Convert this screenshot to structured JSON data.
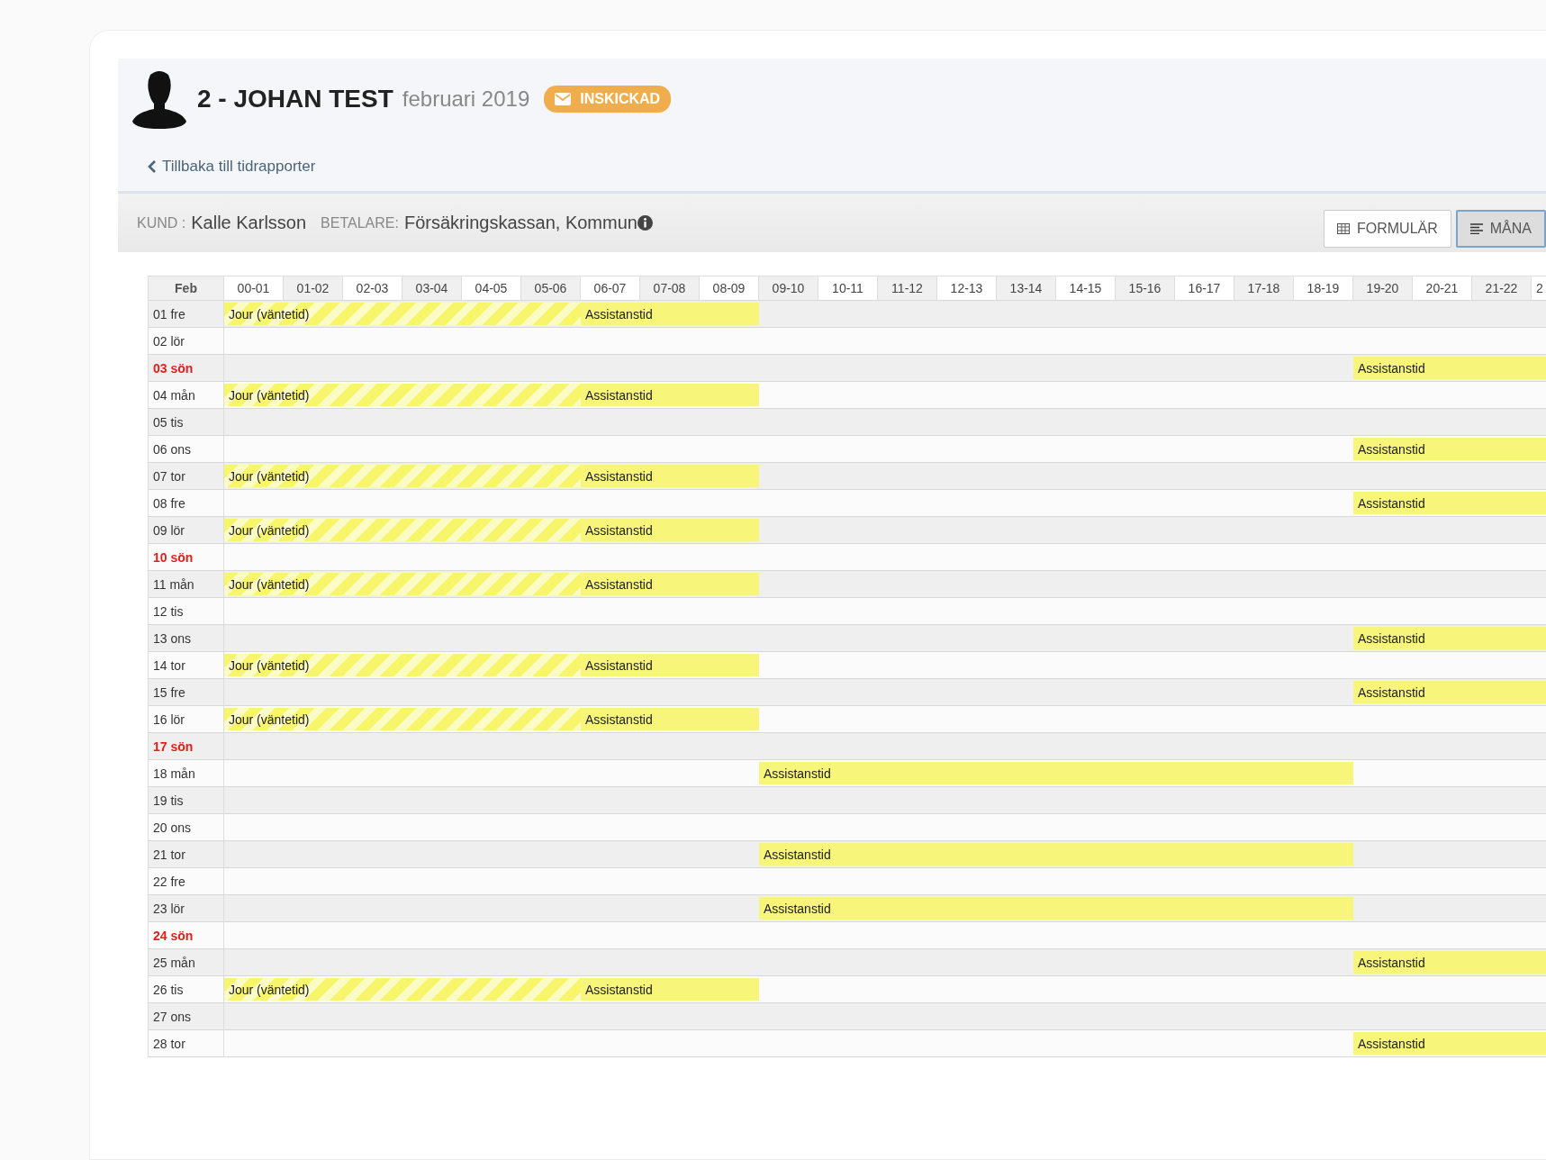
{
  "header": {
    "title": "2 - JOHAN TEST",
    "period": "februari 2019",
    "status": "INSKICKAD",
    "back_link": "Tillbaka till tidrapporter"
  },
  "info_bar": {
    "customer_label": "KUND :",
    "customer": "Kalle Karlsson",
    "payer_label": "BETALARE:",
    "payer": "Försäkringskassan, Kommun",
    "view_buttons": [
      {
        "label": "FORMULÄR",
        "kind": "form",
        "selected": false
      },
      {
        "label": "MÅNA",
        "kind": "month",
        "selected": true
      }
    ]
  },
  "table": {
    "corner": "Feb",
    "columns": [
      "00-01",
      "01-02",
      "02-03",
      "03-04",
      "04-05",
      "05-06",
      "06-07",
      "07-08",
      "08-09",
      "09-10",
      "10-11",
      "11-12",
      "12-13",
      "13-14",
      "14-15",
      "15-16",
      "16-17",
      "17-18",
      "18-19",
      "19-20",
      "20-21",
      "21-22",
      "2"
    ],
    "days": [
      {
        "label": "01 fre",
        "sunday": false,
        "shifts": [
          {
            "kind": "night",
            "label": "Jour (väntetid)"
          },
          {
            "kind": "morning",
            "label": "Assistanstid"
          }
        ]
      },
      {
        "label": "02 lör",
        "sunday": false
      },
      {
        "label": "03 sön",
        "sunday": true,
        "shifts": [
          {
            "kind": "evening",
            "label": "Assistanstid"
          }
        ]
      },
      {
        "label": "04 mån",
        "sunday": false,
        "shifts": [
          {
            "kind": "night",
            "label": "Jour (väntetid)"
          },
          {
            "kind": "morning",
            "label": "Assistanstid"
          }
        ]
      },
      {
        "label": "05 tis",
        "sunday": false
      },
      {
        "label": "06 ons",
        "sunday": false,
        "shifts": [
          {
            "kind": "evening",
            "label": "Assistanstid"
          }
        ]
      },
      {
        "label": "07 tor",
        "sunday": false,
        "shifts": [
          {
            "kind": "night",
            "label": "Jour (väntetid)"
          },
          {
            "kind": "morning",
            "label": "Assistanstid"
          }
        ]
      },
      {
        "label": "08 fre",
        "sunday": false,
        "shifts": [
          {
            "kind": "evening",
            "label": "Assistanstid"
          }
        ]
      },
      {
        "label": "09 lör",
        "sunday": false,
        "shifts": [
          {
            "kind": "night",
            "label": "Jour (väntetid)"
          },
          {
            "kind": "morning",
            "label": "Assistanstid"
          }
        ]
      },
      {
        "label": "10 sön",
        "sunday": true
      },
      {
        "label": "11 mån",
        "sunday": false,
        "shifts": [
          {
            "kind": "night",
            "label": "Jour (väntetid)"
          },
          {
            "kind": "morning",
            "label": "Assistanstid"
          }
        ]
      },
      {
        "label": "12 tis",
        "sunday": false
      },
      {
        "label": "13 ons",
        "sunday": false,
        "shifts": [
          {
            "kind": "evening",
            "label": "Assistanstid"
          }
        ]
      },
      {
        "label": "14 tor",
        "sunday": false,
        "shifts": [
          {
            "kind": "night",
            "label": "Jour (väntetid)"
          },
          {
            "kind": "morning",
            "label": "Assistanstid"
          }
        ]
      },
      {
        "label": "15 fre",
        "sunday": false,
        "shifts": [
          {
            "kind": "evening",
            "label": "Assistanstid"
          }
        ]
      },
      {
        "label": "16 lör",
        "sunday": false,
        "shifts": [
          {
            "kind": "night",
            "label": "Jour (väntetid)"
          },
          {
            "kind": "morning",
            "label": "Assistanstid"
          }
        ]
      },
      {
        "label": "17 sön",
        "sunday": true
      },
      {
        "label": "18 mån",
        "sunday": false,
        "shifts": [
          {
            "kind": "day",
            "label": "Assistanstid"
          }
        ]
      },
      {
        "label": "19 tis",
        "sunday": false
      },
      {
        "label": "20 ons",
        "sunday": false
      },
      {
        "label": "21 tor",
        "sunday": false,
        "shifts": [
          {
            "kind": "day",
            "label": "Assistanstid"
          }
        ]
      },
      {
        "label": "22 fre",
        "sunday": false
      },
      {
        "label": "23 lör",
        "sunday": false,
        "shifts": [
          {
            "kind": "day",
            "label": "Assistanstid"
          }
        ]
      },
      {
        "label": "24 sön",
        "sunday": true
      },
      {
        "label": "25 mån",
        "sunday": false,
        "shifts": [
          {
            "kind": "evening",
            "label": "Assistanstid"
          }
        ]
      },
      {
        "label": "26 tis",
        "sunday": false,
        "shifts": [
          {
            "kind": "night",
            "label": "Jour (väntetid)"
          },
          {
            "kind": "morning",
            "label": "Assistanstid"
          }
        ]
      },
      {
        "label": "27 ons",
        "sunday": false
      },
      {
        "label": "28 tor",
        "sunday": false,
        "shifts": [
          {
            "kind": "evening",
            "label": "Assistanstid"
          }
        ]
      }
    ]
  }
}
